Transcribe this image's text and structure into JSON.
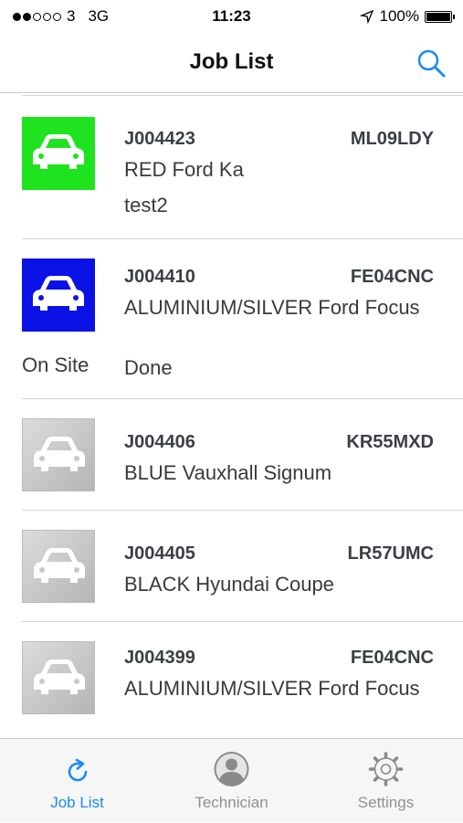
{
  "status_bar": {
    "carrier": "3",
    "network": "3G",
    "time": "11:23",
    "battery": "100%"
  },
  "nav": {
    "title": "Job List"
  },
  "jobs": [
    {
      "job_number": "J004423",
      "registration": "ML09LDY",
      "description": "RED Ford Ka",
      "notes": "test2",
      "status": "",
      "color": "#1fe31f"
    },
    {
      "job_number": "J004410",
      "registration": "FE04CNC",
      "description": "ALUMINIUM/SILVER Ford Focus",
      "notes": "Done",
      "status": "On Site",
      "color": "#0b12e6"
    },
    {
      "job_number": "J004406",
      "registration": "KR55MXD",
      "description": "BLUE Vauxhall Signum",
      "notes": "",
      "status": "",
      "color": "grey"
    },
    {
      "job_number": "J004405",
      "registration": "LR57UMC",
      "description": "BLACK Hyundai Coupe",
      "notes": "",
      "status": "",
      "color": "grey"
    },
    {
      "job_number": "J004399",
      "registration": "FE04CNC",
      "description": "ALUMINIUM/SILVER Ford Focus",
      "notes": "",
      "status": "",
      "color": "grey"
    }
  ],
  "tabs": [
    {
      "label": "Job List",
      "icon": "refresh-icon",
      "active": true
    },
    {
      "label": "Technician",
      "icon": "person-icon",
      "active": false
    },
    {
      "label": "Settings",
      "icon": "gear-icon",
      "active": false
    }
  ],
  "colors": {
    "accent": "#1a8cf0",
    "tab_inactive": "#909090"
  }
}
